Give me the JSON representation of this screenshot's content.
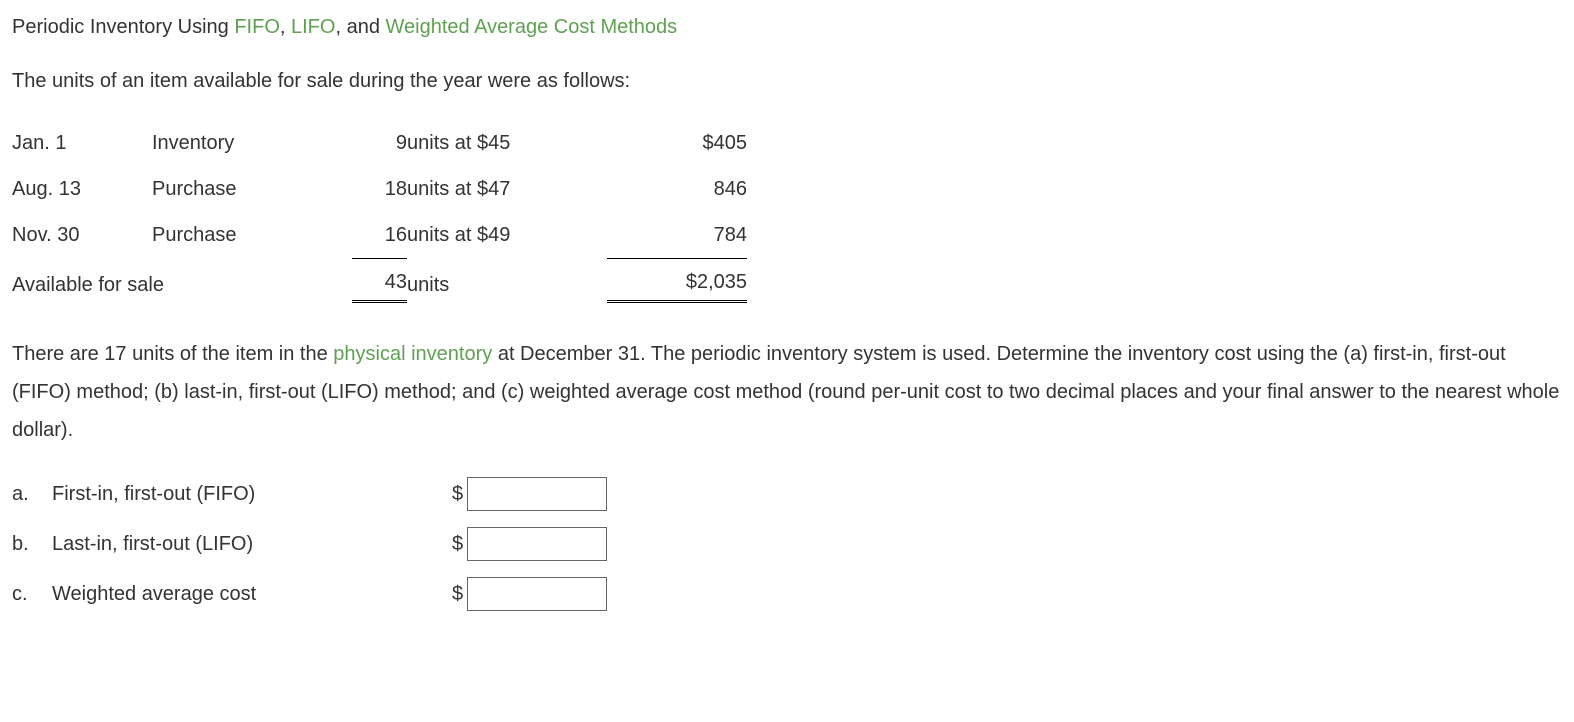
{
  "title": {
    "prefix": "Periodic Inventory Using ",
    "fifo": "FIFO",
    "sep1": ", ",
    "lifo": "LIFO",
    "sep2": ", and ",
    "wac": "Weighted Average Cost Methods"
  },
  "intro": "The units of an item available for sale during the year were as follows:",
  "table": {
    "rows": [
      {
        "date": "Jan. 1",
        "type": "Inventory",
        "units": "9",
        "desc": "units at $45",
        "amt": "$405"
      },
      {
        "date": "Aug. 13",
        "type": "Purchase",
        "units": "18",
        "desc": "units at $47",
        "amt": "846"
      },
      {
        "date": "Nov. 30",
        "type": "Purchase",
        "units": "16",
        "desc": "units at $49",
        "amt": "784"
      }
    ],
    "total": {
      "label": "Available for sale",
      "units": "43",
      "desc": "units",
      "amt": "$2,035"
    }
  },
  "instructions": {
    "p1a": "There are 17 units of the item in the ",
    "p1link": "physical inventory",
    "p1b": " at December 31. The periodic inventory system is used. Determine the inventory cost using the (a) first-in, first-out (FIFO) method; (b) last-in, first-out (LIFO) method; and (c) weighted average cost method (round per-unit cost to two decimal places and your final answer to the nearest whole dollar)."
  },
  "answers": [
    {
      "letter": "a.",
      "label": "First-in, first-out (FIFO)",
      "currency": "$"
    },
    {
      "letter": "b.",
      "label": "Last-in, first-out (LIFO)",
      "currency": "$"
    },
    {
      "letter": "c.",
      "label": "Weighted average cost",
      "currency": "$"
    }
  ]
}
